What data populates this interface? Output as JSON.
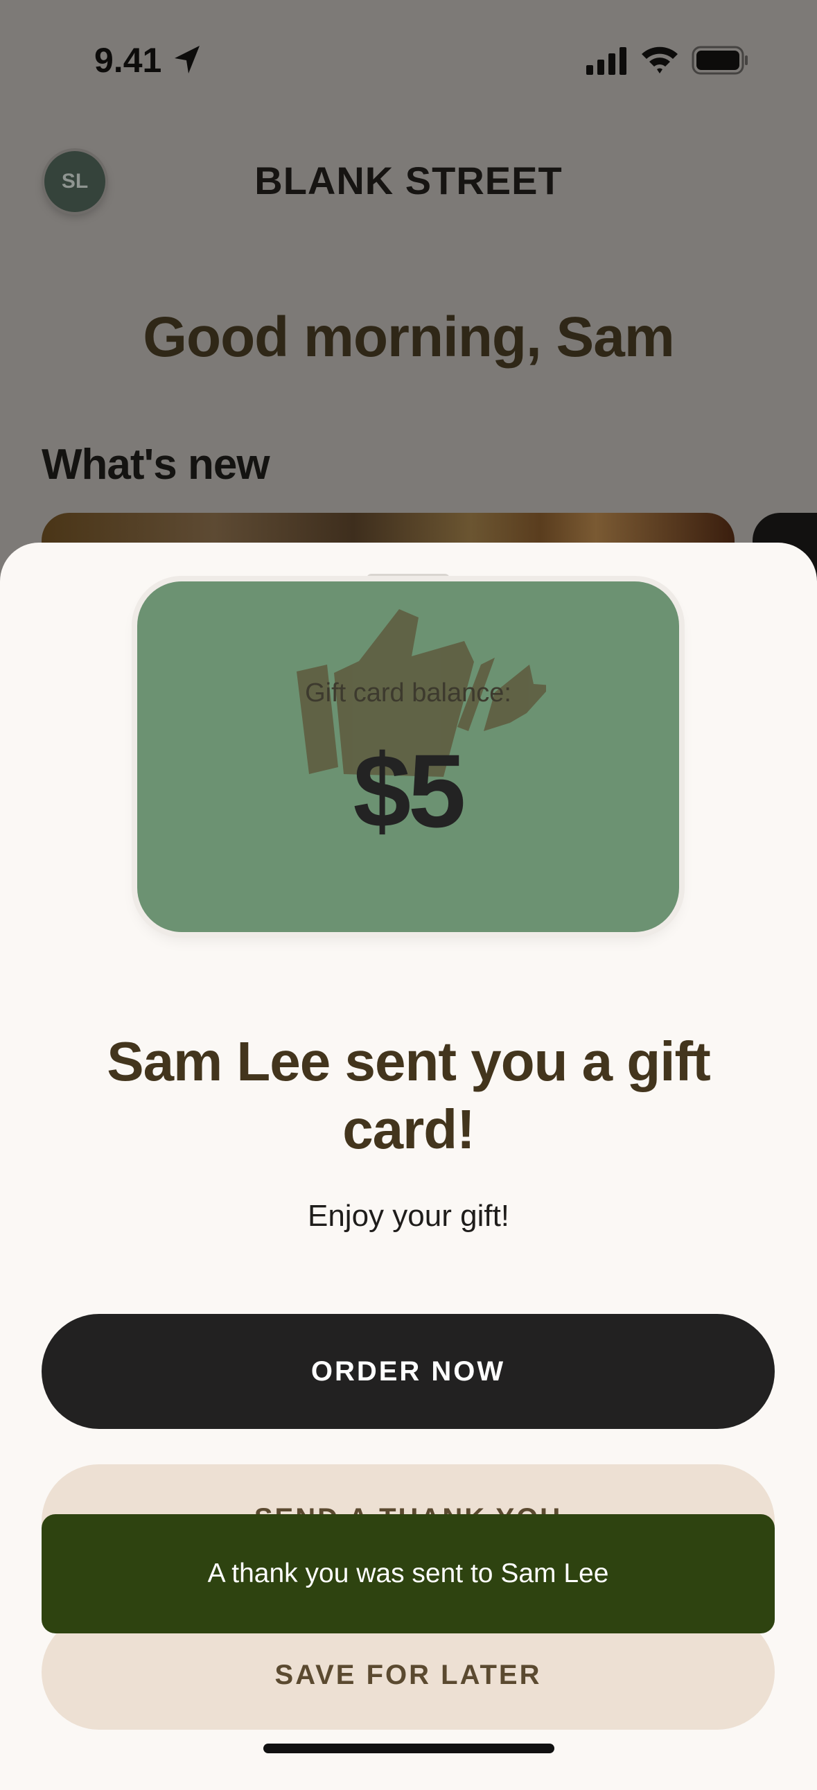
{
  "status_bar": {
    "time": "9.41"
  },
  "header": {
    "avatar_initials": "SL",
    "brand": "BLANK STREET"
  },
  "home": {
    "greeting": "Good morning, Sam",
    "section_title": "What's new"
  },
  "gift_card": {
    "balance_label": "Gift card balance:",
    "balance_amount": "$5",
    "card_color": "#6c9272"
  },
  "sheet": {
    "title": "Sam Lee sent you a gift card!",
    "subtitle": "Enjoy your gift!",
    "order_button": "ORDER NOW",
    "thank_button": "SEND A THANK YOU",
    "save_button": "SAVE FOR LATER"
  },
  "toast": {
    "message": "A thank you was sent to Sam Lee",
    "color": "#2e4310"
  },
  "icons": [
    "location-arrow-icon",
    "cellular-signal-icon",
    "wifi-icon",
    "battery-icon",
    "thumbs-up-icon"
  ]
}
